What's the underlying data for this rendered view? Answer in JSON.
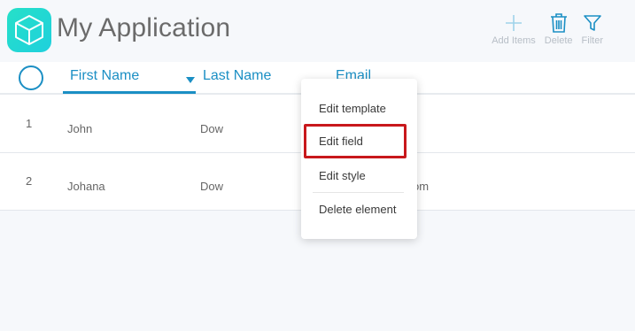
{
  "app": {
    "title": "My Application",
    "brand_color": "#1fd4d0"
  },
  "toolbar": {
    "items": [
      {
        "label": "Add Items",
        "icon": "plus-icon"
      },
      {
        "label": "Delete",
        "icon": "trash-icon"
      },
      {
        "label": "Filter",
        "icon": "filter-icon"
      }
    ]
  },
  "table": {
    "columns": [
      "First Name",
      "Last Name",
      "Email"
    ],
    "active_column": "First Name",
    "sort_indicator": "chevron-down-icon",
    "rows": [
      {
        "num": "1",
        "first": "John",
        "last": "Dow",
        "email": ""
      },
      {
        "num": "2",
        "first": "Johana",
        "last": "Dow",
        "email": "om"
      }
    ]
  },
  "context_menu": {
    "items": [
      "Edit template",
      "Edit field",
      "Edit style",
      "Delete element"
    ],
    "highlighted": "Edit field"
  },
  "colors": {
    "accent": "#1b8fc4",
    "highlight": "#c8181c",
    "muted_text": "#b7bec6"
  }
}
